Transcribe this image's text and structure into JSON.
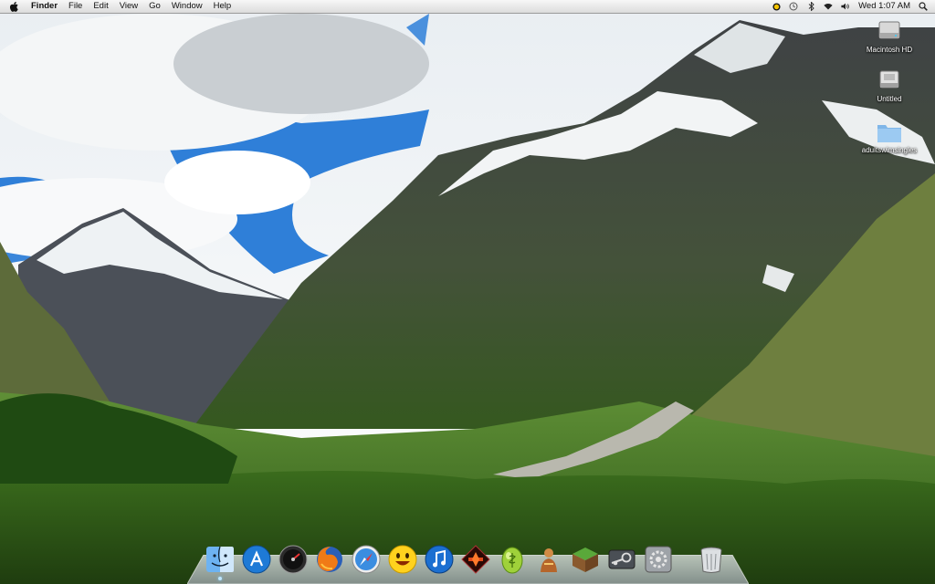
{
  "menubar": {
    "app_name": "Finder",
    "menus": [
      "File",
      "Edit",
      "View",
      "Go",
      "Window",
      "Help"
    ],
    "clock": "Wed 1:07 AM"
  },
  "status_icons": [
    "status-dot-icon",
    "time-machine-icon",
    "bluetooth-icon",
    "wifi-icon",
    "volume-icon",
    "spotlight-icon"
  ],
  "desktop_icons": [
    {
      "label": "Macintosh HD",
      "icon": "hard-drive-icon"
    },
    {
      "label": "Untitled",
      "icon": "disk-icon"
    },
    {
      "label": "adultswimsingles",
      "icon": "folder-icon"
    }
  ],
  "dock": {
    "apps": [
      {
        "name": "Finder",
        "icon": "finder-icon"
      },
      {
        "name": "App Store",
        "icon": "app-store-icon"
      },
      {
        "name": "Dashboard",
        "icon": "dashboard-icon"
      },
      {
        "name": "Firefox",
        "icon": "firefox-icon"
      },
      {
        "name": "Safari",
        "icon": "safari-icon"
      },
      {
        "name": "Messenger",
        "icon": "smiley-icon"
      },
      {
        "name": "iTunes",
        "icon": "itunes-icon"
      },
      {
        "name": "Diablo",
        "icon": "diablo-icon"
      },
      {
        "name": "Egg app",
        "icon": "egg-icon"
      },
      {
        "name": "Character",
        "icon": "character-icon"
      },
      {
        "name": "Minecraft",
        "icon": "minecraft-icon"
      },
      {
        "name": "Steam",
        "icon": "steam-icon"
      },
      {
        "name": "System Preferences",
        "icon": "system-preferences-icon"
      }
    ],
    "trash": {
      "name": "Trash",
      "icon": "trash-icon"
    }
  },
  "colors": {
    "menubar": "#e8e8e8",
    "sky": "#2f7fd8",
    "grass": "#3e7a22",
    "rock": "#4a4d45"
  }
}
